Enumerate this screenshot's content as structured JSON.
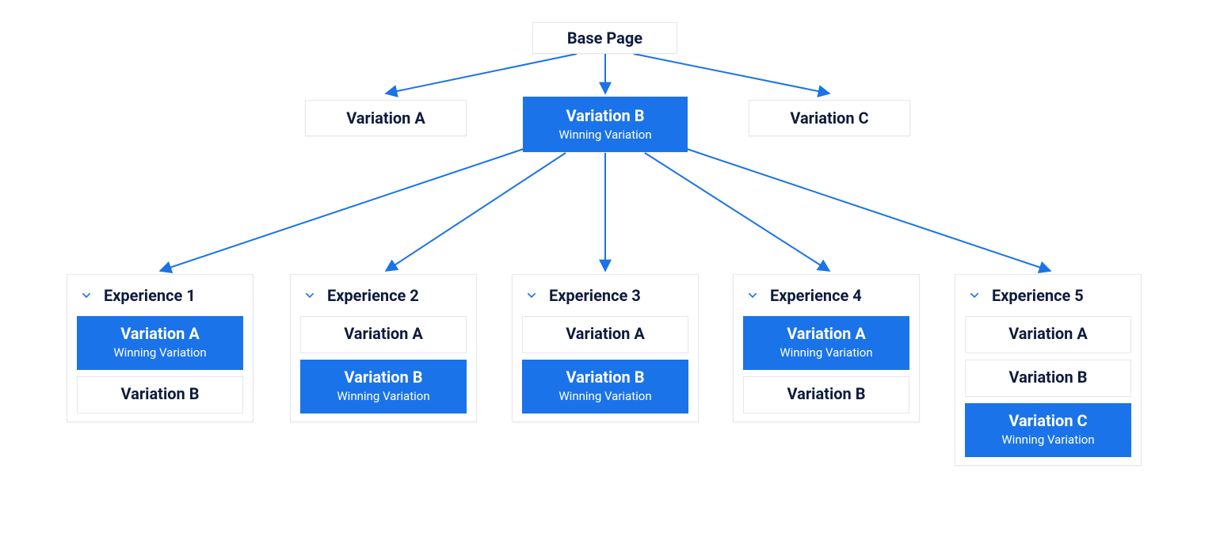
{
  "colors": {
    "accent": "#1a73e8",
    "text": "#0e1b3d",
    "border": "#e3e7ee"
  },
  "root": {
    "label": "Base Page"
  },
  "level1": {
    "a": {
      "label": "Variation A"
    },
    "b": {
      "label": "Variation B",
      "sub": "Winning Variation",
      "winning": true
    },
    "c": {
      "label": "Variation C"
    }
  },
  "experiences": [
    {
      "title": "Experience 1",
      "variations": [
        {
          "label": "Variation A",
          "sub": "Winning Variation",
          "winning": true
        },
        {
          "label": "Variation B"
        }
      ]
    },
    {
      "title": "Experience 2",
      "variations": [
        {
          "label": "Variation A"
        },
        {
          "label": "Variation B",
          "sub": "Winning Variation",
          "winning": true
        }
      ]
    },
    {
      "title": "Experience 3",
      "variations": [
        {
          "label": "Variation A"
        },
        {
          "label": "Variation B",
          "sub": "Winning Variation",
          "winning": true
        }
      ]
    },
    {
      "title": "Experience 4",
      "variations": [
        {
          "label": "Variation A",
          "sub": "Winning Variation",
          "winning": true
        },
        {
          "label": "Variation B"
        }
      ]
    },
    {
      "title": "Experience 5",
      "variations": [
        {
          "label": "Variation A"
        },
        {
          "label": "Variation B"
        },
        {
          "label": "Variation C",
          "sub": "Winning Variation",
          "winning": true
        }
      ]
    }
  ]
}
